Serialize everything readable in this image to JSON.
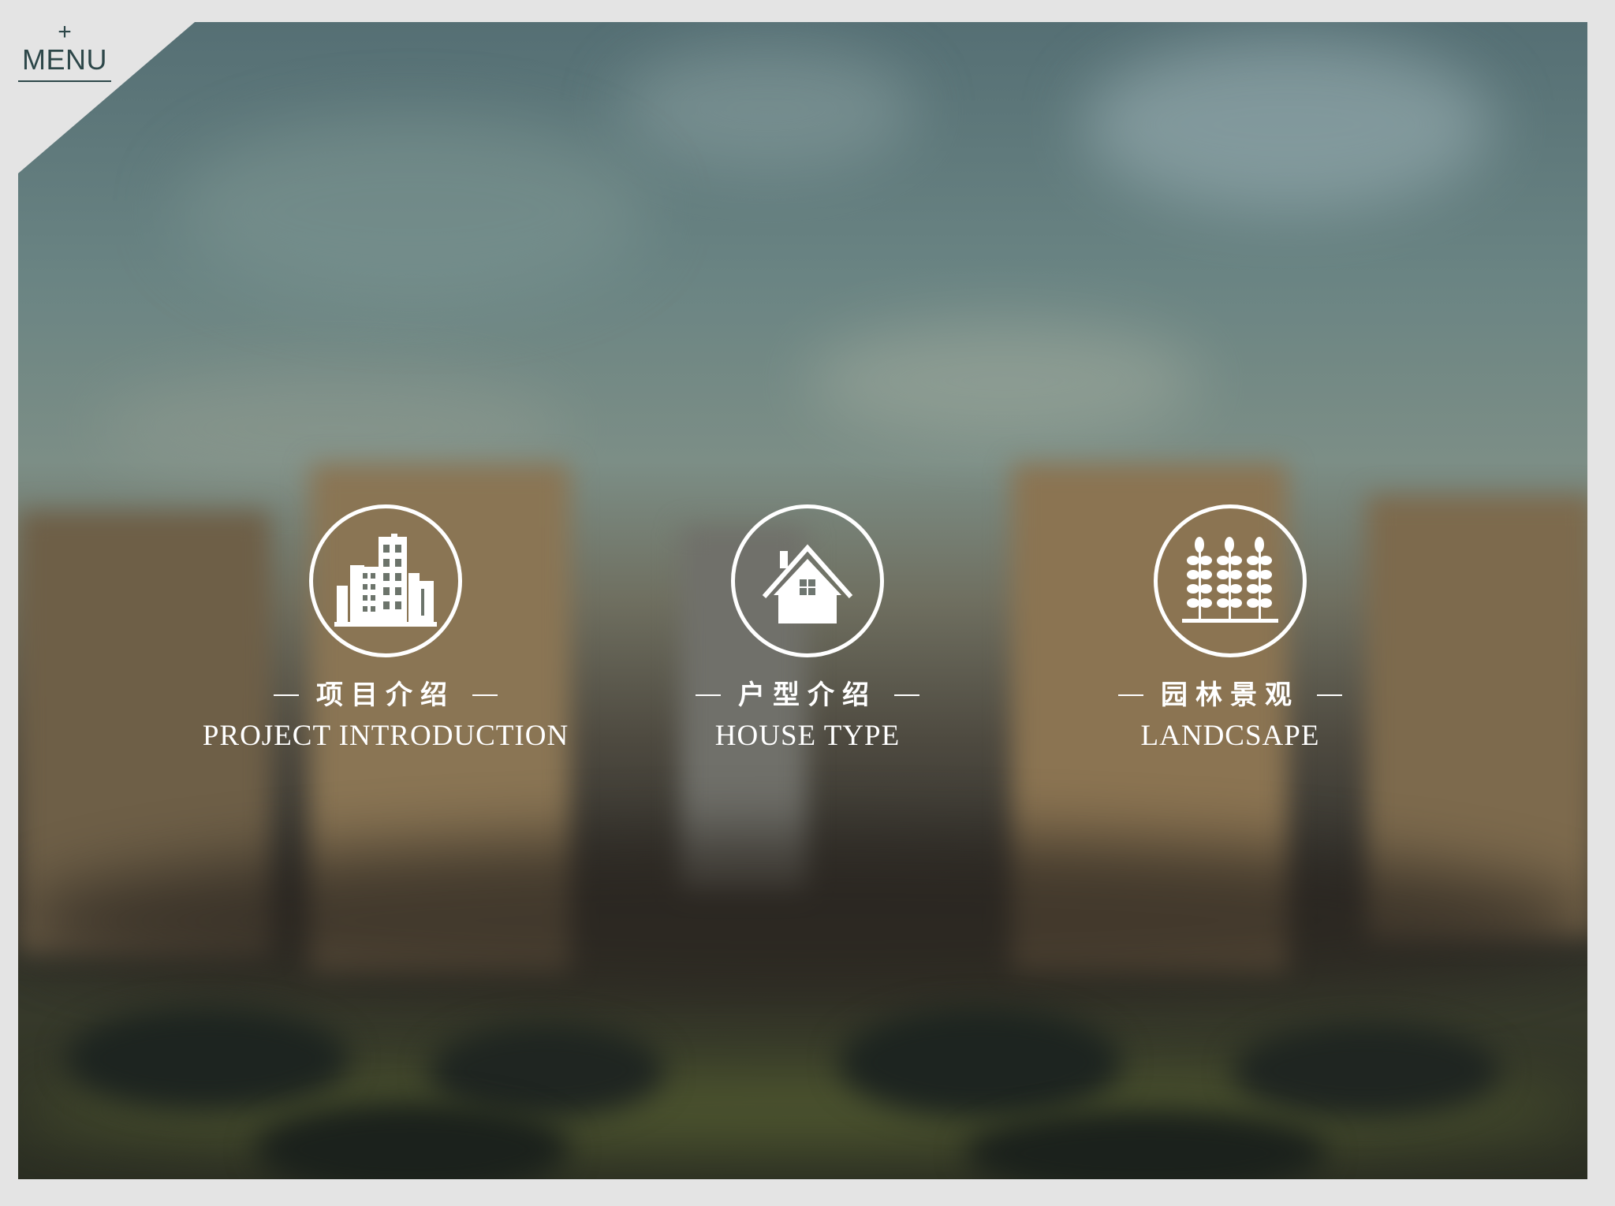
{
  "menu": {
    "plus": "+",
    "label": "MENU"
  },
  "features": [
    {
      "title_cn": "项目介绍",
      "title_en": "PROJECT INTRODUCTION",
      "icon": "city-buildings-icon"
    },
    {
      "title_cn": "户型介绍",
      "title_en": "HOUSE TYPE",
      "icon": "house-icon"
    },
    {
      "title_cn": "园林景观",
      "title_en": "LANDCSAPE",
      "icon": "trees-icon"
    }
  ],
  "colors": {
    "menu_text": "#2d4749",
    "frame": "#e4e4e4",
    "feature_text": "#ffffff"
  }
}
